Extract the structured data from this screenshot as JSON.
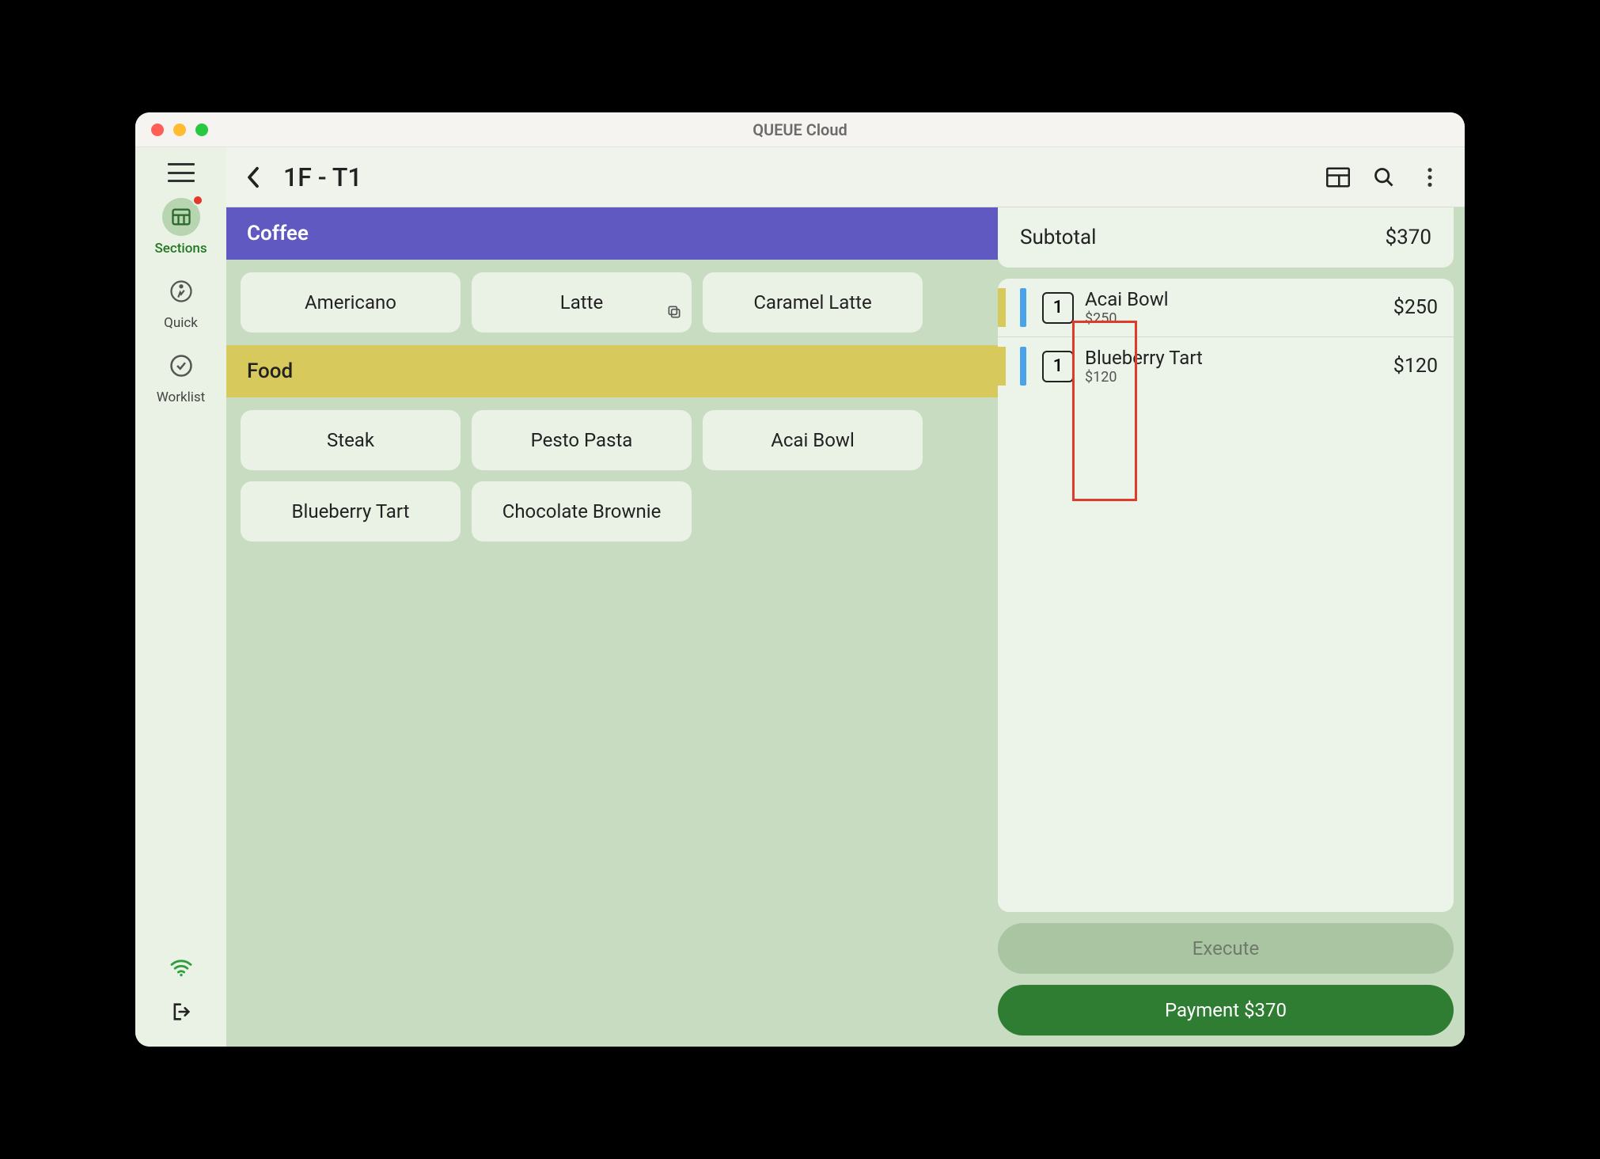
{
  "window": {
    "title": "QUEUE Cloud"
  },
  "sidebar": {
    "items": [
      {
        "id": "sections",
        "label": "Sections",
        "active": true,
        "badge": true
      },
      {
        "id": "quick",
        "label": "Quick",
        "active": false,
        "badge": false
      },
      {
        "id": "worklist",
        "label": "Worklist",
        "active": false,
        "badge": false
      }
    ]
  },
  "header": {
    "title": "1F - T1"
  },
  "menu": {
    "sections": [
      {
        "name": "Coffee",
        "style": "coffee",
        "items": [
          {
            "label": "Americano",
            "has_copy": false
          },
          {
            "label": "Latte",
            "has_copy": true
          },
          {
            "label": "Caramel Latte",
            "has_copy": false
          }
        ]
      },
      {
        "name": "Food",
        "style": "food",
        "items": [
          {
            "label": "Steak",
            "has_copy": false
          },
          {
            "label": "Pesto Pasta",
            "has_copy": false
          },
          {
            "label": "Acai Bowl",
            "has_copy": false
          },
          {
            "label": "Blueberry Tart",
            "has_copy": false
          },
          {
            "label": "Chocolate Brownie",
            "has_copy": false
          }
        ]
      }
    ]
  },
  "order": {
    "subtotal_label": "Subtotal",
    "subtotal_value": "$370",
    "lines": [
      {
        "qty": "1",
        "name": "Acai Bowl",
        "unit": "$250",
        "price": "$250",
        "stripe_a": "#d7c95b",
        "stripe_b": "#4aa3ea"
      },
      {
        "qty": "1",
        "name": "Blueberry Tart",
        "unit": "$120",
        "price": "$120",
        "stripe_a": "#d7c95b",
        "stripe_b": "#4aa3ea"
      }
    ],
    "execute_label": "Execute",
    "payment_label": "Payment $370"
  }
}
